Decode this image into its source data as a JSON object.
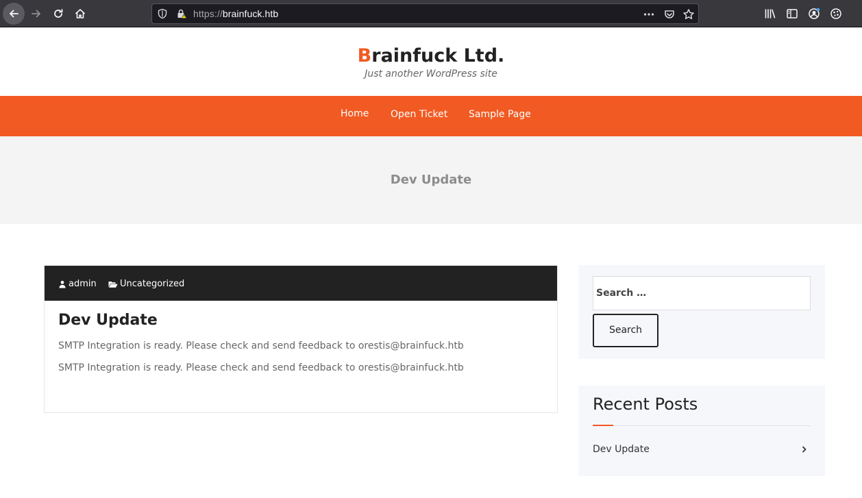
{
  "browser": {
    "url_scheme": "https://",
    "url_host": "brainfuck.htb",
    "icons": [
      "back-icon",
      "forward-icon",
      "reload-icon",
      "home-icon",
      "tracking-shield-icon",
      "insecure-lock-icon",
      "more-dots-icon",
      "pocket-icon",
      "bookmark-star-icon",
      "library-icon",
      "sidebar-icon",
      "account-icon",
      "extension-icon"
    ]
  },
  "site": {
    "title_first": "B",
    "title_rest": "rainfuck Ltd.",
    "tagline": "Just another WordPress site",
    "accent_color": "#f15a22"
  },
  "nav": {
    "items": [
      "Home",
      "Open Ticket",
      "Sample Page"
    ]
  },
  "page": {
    "banner_title": "Dev Update"
  },
  "post": {
    "author": "admin",
    "category": "Uncategorized",
    "title": "Dev Update",
    "paragraphs": [
      "SMTP Integration is ready. Please check and send feedback to orestis@brainfuck.htb",
      "SMTP Integration is ready. Please check and send feedback to orestis@brainfuck.htb"
    ]
  },
  "sidebar": {
    "search_placeholder": "Search …",
    "search_button": "Search",
    "recent_heading": "Recent Posts",
    "recent_items": [
      "Dev Update"
    ]
  }
}
